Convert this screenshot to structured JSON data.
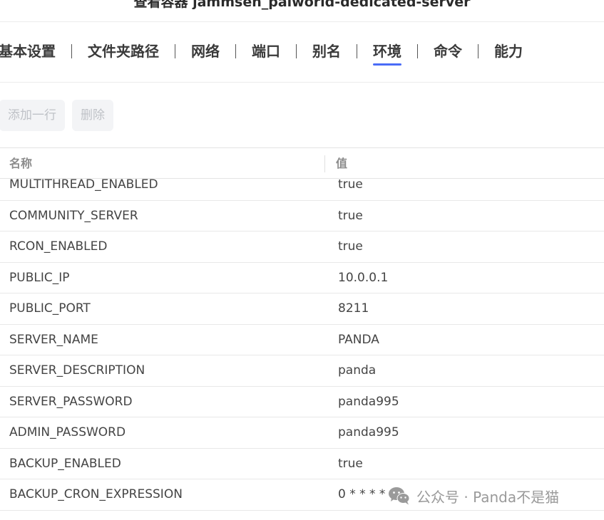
{
  "window": {
    "title": "查看容器 jammsen_palworld-dedicated-server"
  },
  "tabs": [
    {
      "label": "基本设置",
      "active": false
    },
    {
      "label": "文件夹路径",
      "active": false
    },
    {
      "label": "网络",
      "active": false
    },
    {
      "label": "端口",
      "active": false
    },
    {
      "label": "别名",
      "active": false
    },
    {
      "label": "环境",
      "active": true
    },
    {
      "label": "命令",
      "active": false
    },
    {
      "label": "能力",
      "active": false
    }
  ],
  "actions": {
    "add_row_label": "添加一行",
    "delete_label": "删除"
  },
  "table": {
    "columns": {
      "name": "名称",
      "value": "值"
    },
    "rows": [
      {
        "name": "MULTITHREAD_ENABLED",
        "value": "true"
      },
      {
        "name": "COMMUNITY_SERVER",
        "value": "true"
      },
      {
        "name": "RCON_ENABLED",
        "value": "true"
      },
      {
        "name": "PUBLIC_IP",
        "value": "10.0.0.1"
      },
      {
        "name": "PUBLIC_PORT",
        "value": "8211"
      },
      {
        "name": "SERVER_NAME",
        "value": "PANDA"
      },
      {
        "name": "SERVER_DESCRIPTION",
        "value": "panda"
      },
      {
        "name": "SERVER_PASSWORD",
        "value": "panda995"
      },
      {
        "name": "ADMIN_PASSWORD",
        "value": "panda995"
      },
      {
        "name": "BACKUP_ENABLED",
        "value": "true"
      },
      {
        "name": "BACKUP_CRON_EXPRESSION",
        "value": "0 * * * *"
      }
    ]
  },
  "watermark": {
    "text": "公众号 · Panda不是猫",
    "icon": "wechat-icon"
  },
  "colors": {
    "accent": "#4a6cf7",
    "disabled_text": "#bfc2c7",
    "disabled_bg": "#f3f4f6"
  }
}
